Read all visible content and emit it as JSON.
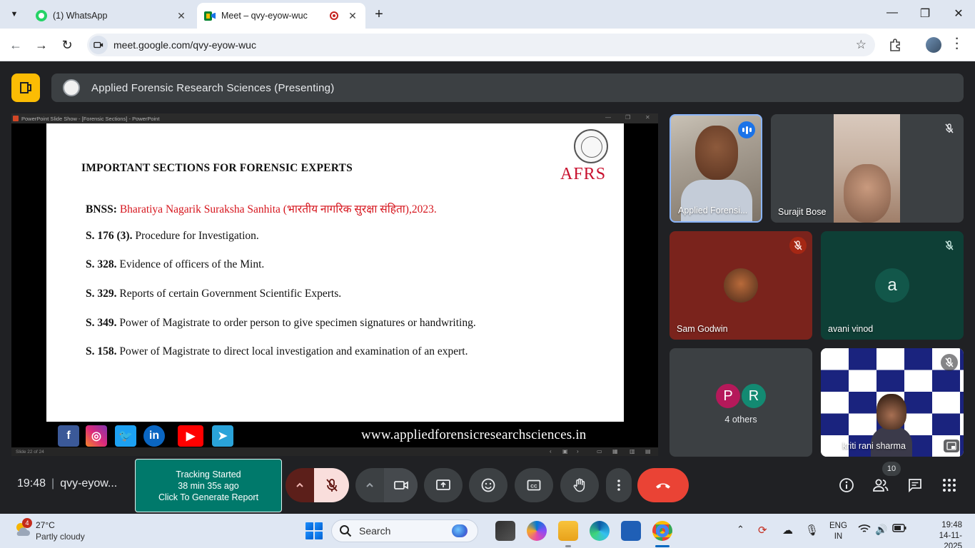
{
  "browser": {
    "tabs": [
      {
        "title": "(1) WhatsApp",
        "active": false
      },
      {
        "title": "Meet – qvy-eyow-wuc",
        "active": true
      }
    ],
    "url": "meet.google.com/qvy-eyow-wuc"
  },
  "meet": {
    "presenting_title": "Applied Forensic Research Sciences (Presenting)",
    "time": "19:48",
    "meeting_code": "qvy-eyow...",
    "people_count": "10",
    "tracker": {
      "line1": "Tracking Started",
      "line2": "38 min 35s ago",
      "line3": "Click To Generate Report"
    },
    "participants": [
      {
        "name": "Applied Forensi...",
        "speaking": true
      },
      {
        "name": "Surajit Bose",
        "muted": true
      },
      {
        "name": "Sam Godwin",
        "muted": true
      },
      {
        "name": "avani vinod",
        "muted": true,
        "initial": "a"
      },
      {
        "name": "4 others",
        "initials": [
          "P",
          "R"
        ]
      },
      {
        "name": "kriti rani sharma",
        "muted": true
      }
    ],
    "colors": {
      "accent": "#8ab4f8",
      "end_call": "#ea4335",
      "mic_off_active": "#f9dedc",
      "tracker": "#00796b"
    }
  },
  "slide": {
    "window_title": "PowerPoint Slide Show - [Forensic Sections] - PowerPoint",
    "heading": "IMPORTANT SECTIONS FOR FORENSIC EXPERTS",
    "logo_text": "AFRS",
    "lines": [
      {
        "label": "BNSS:",
        "text": "Bharatiya Nagarik Suraksha Sanhita (भारतीय नागरिक सुरक्षा संहिता),2023."
      },
      {
        "label": "S. 176 (3).",
        "text": "Procedure for Investigation."
      },
      {
        "label": "S. 328.",
        "text": "Evidence of officers of the Mint."
      },
      {
        "label": "S. 329.",
        "text": "Reports of certain Government Scientific Experts."
      },
      {
        "label": "S. 349.",
        "text": "Power of Magistrate to order person to give specimen signatures or handwriting."
      },
      {
        "label": "S. 158.",
        "text": "Power of Magistrate to direct local investigation and examination of an expert."
      }
    ],
    "footer_url": "www.appliedforensicresearchsciences.in",
    "social_icons": [
      "facebook-icon",
      "instagram-icon",
      "twitter-icon",
      "linkedin-icon",
      "youtube-icon",
      "telegram-icon"
    ],
    "status": "Slide 22 of 24"
  },
  "taskbar": {
    "weather_temp": "27°C",
    "weather_desc": "Partly cloudy",
    "weather_badge": "4",
    "search_label": "Search",
    "lang_line1": "ENG",
    "lang_line2": "IN",
    "time": "19:48",
    "date": "14-11-2025"
  }
}
